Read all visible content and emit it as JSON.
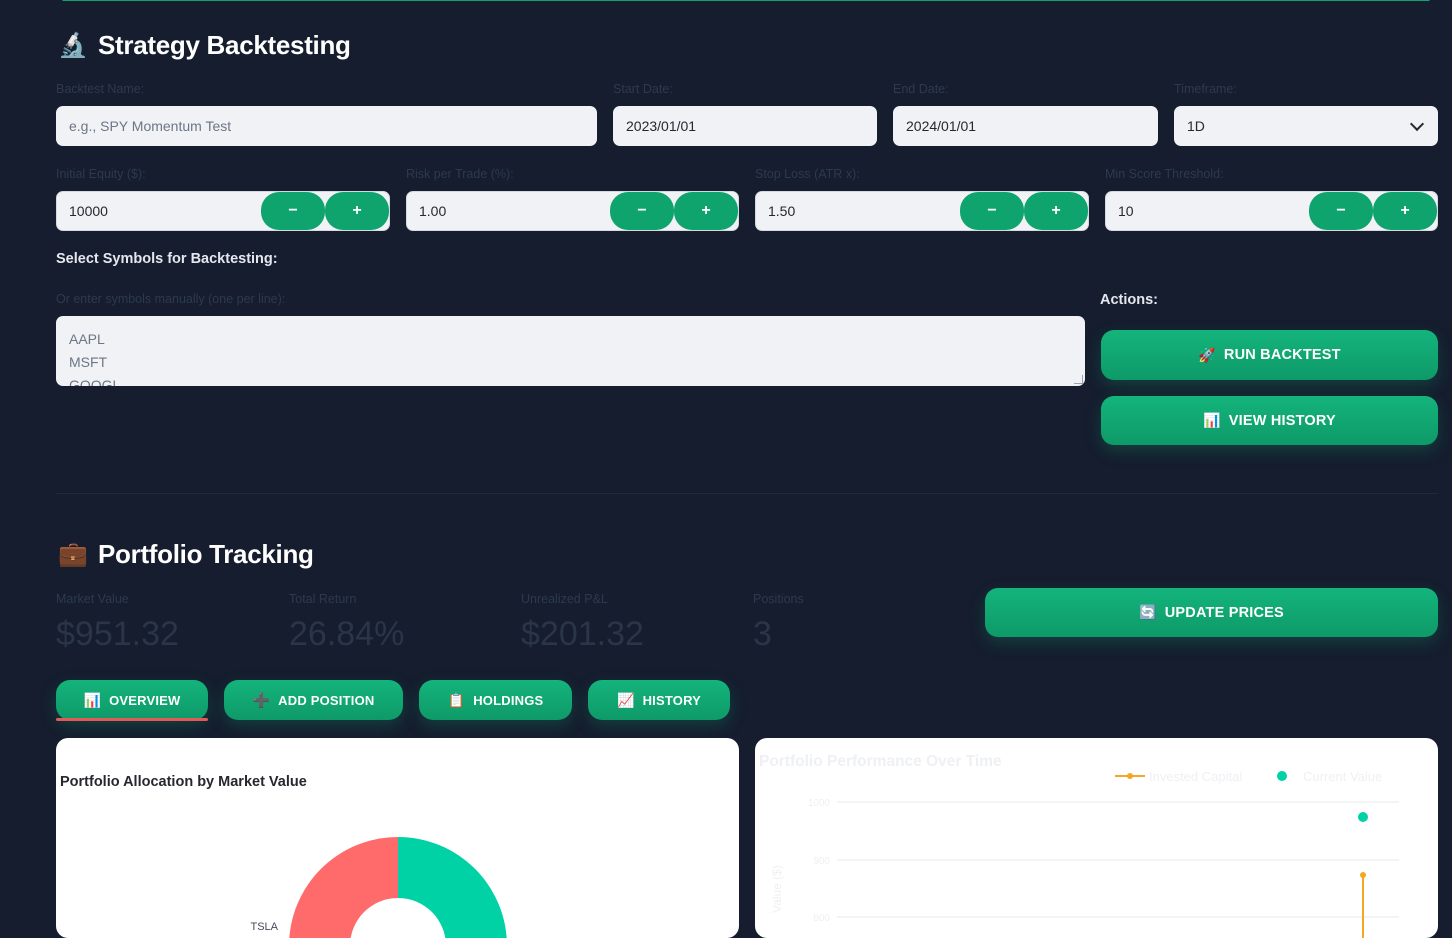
{
  "backtesting": {
    "icon": "microscope-icon",
    "title": "Strategy Backtesting",
    "name_label": "Backtest Name:",
    "name_placeholder": "e.g., SPY Momentum Test",
    "start_label": "Start Date:",
    "start_value": "2023/01/01",
    "end_label": "End Date:",
    "end_value": "2024/01/01",
    "timeframe_label": "Timeframe:",
    "timeframe_value": "1D",
    "equity_label": "Initial Equity ($):",
    "equity_value": "10000",
    "risk_label": "Risk per Trade (%):",
    "risk_value": "1.00",
    "stop_label": "Stop Loss (ATR x):",
    "stop_value": "1.50",
    "score_label": "Min Score Threshold:",
    "score_value": "10",
    "minus": "−",
    "plus": "+",
    "symbols_heading": "Select Symbols for Backtesting:",
    "manual_label": "Or enter symbols manually (one per line):",
    "symbols": [
      "AAPL",
      "MSFT",
      "GOOGL"
    ],
    "actions_label": "Actions:",
    "run_label": "RUN BACKTEST",
    "run_icon": "rocket-icon",
    "history_label": "VIEW HISTORY",
    "history_icon": "bar-chart-icon"
  },
  "portfolio": {
    "icon": "briefcase-icon",
    "title": "Portfolio Tracking",
    "metrics": [
      {
        "label": "Market Value",
        "value": "$951.32"
      },
      {
        "label": "Total Return",
        "value": "26.84%"
      },
      {
        "label": "Unrealized P&L",
        "value": "$201.32"
      },
      {
        "label": "Positions",
        "value": "3"
      }
    ],
    "update_label": "UPDATE PRICES",
    "update_icon": "refresh-icon",
    "tabs": [
      {
        "label": "OVERVIEW",
        "icon": "bar-chart-icon"
      },
      {
        "label": "ADD POSITION",
        "icon": "plus-icon"
      },
      {
        "label": "HOLDINGS",
        "icon": "clipboard-icon"
      },
      {
        "label": "HISTORY",
        "icon": "line-chart-icon"
      }
    ],
    "active_tab": "OVERVIEW"
  },
  "chart_data": [
    {
      "type": "pie",
      "title": "Portfolio Allocation by Market Value",
      "labels": [
        "TSLA"
      ],
      "colors": [
        "#ff6b6b",
        "#00d2a5"
      ]
    },
    {
      "type": "line",
      "title": "Portfolio Performance Over Time",
      "series": [
        {
          "name": "Invested Capital",
          "color": "#f5a623",
          "values": [
            750
          ]
        },
        {
          "name": "Current Value",
          "color": "#00d2a5",
          "values": [
            951
          ]
        }
      ],
      "ytick_labels": [
        "1000",
        "900",
        "800"
      ],
      "ylabel": "Value ($)",
      "legend": "top-right",
      "grid": true
    }
  ]
}
